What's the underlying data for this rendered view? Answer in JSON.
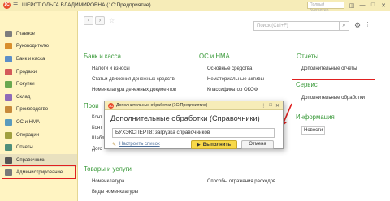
{
  "window": {
    "logo": "1С",
    "title": "ШЕРСТ ОЛЬГА ВЛАДИМИРОВНА  (1С:Предприятие)",
    "search_hint": "Полный Бухгалтер",
    "controls": [
      "◫",
      "—",
      "□",
      "✕"
    ]
  },
  "sidebar": {
    "items": [
      {
        "label": "Главное",
        "icon_color": "#7d7d7d"
      },
      {
        "label": "Руководителю",
        "icon_color": "#d98f2d"
      },
      {
        "label": "Банк и касса",
        "icon_color": "#5d8fc7"
      },
      {
        "label": "Продажи",
        "icon_color": "#d45a5a"
      },
      {
        "label": "Покупки",
        "icon_color": "#6aa84f"
      },
      {
        "label": "Склад",
        "icon_color": "#8f6bb8"
      },
      {
        "label": "Производство",
        "icon_color": "#c78a3b"
      },
      {
        "label": "ОС и НМА",
        "icon_color": "#5a9bbd"
      },
      {
        "label": "Операции",
        "icon_color": "#a0a040"
      },
      {
        "label": "Отчеты",
        "icon_color": "#4f8f7a"
      },
      {
        "label": "Справочники",
        "icon_color": "#555555"
      },
      {
        "label": "Администрирование",
        "icon_color": "#7a7a7a"
      }
    ],
    "active_index": 10
  },
  "toolbar": {
    "back": "‹",
    "forward": "›",
    "star": "☆",
    "search_placeholder": "Поиск (Ctrl+F)",
    "search_btn": "⌕",
    "gear": "⚙",
    "more": "⋮"
  },
  "sections": {
    "bank": {
      "title": "Банк и касса",
      "items": [
        "Налоги и взносы",
        "Статьи движения денежных средств",
        "Номенклатура денежных документов"
      ]
    },
    "os": {
      "title": "ОС и НМА",
      "items": [
        "Основные средства",
        "Нематериальные активы",
        "Классификатор ОКОФ"
      ]
    },
    "reports": {
      "title": "Отчеты",
      "items": [
        "Дополнительные отчеты"
      ]
    },
    "service": {
      "title": "Сервис",
      "items": [
        "Дополнительные обработки"
      ]
    },
    "info": {
      "title": "Информация",
      "items": [
        "Новости"
      ]
    },
    "hidden_left": {
      "title": "Прои",
      "items": [
        "Конт",
        "Конт",
        "Шабл",
        "Дого"
      ]
    },
    "goods": {
      "title": "Товары и услуги",
      "items": [
        "Номенклатура",
        "Виды номенклатуры"
      ]
    },
    "extra_item": "Способы отражения расходов"
  },
  "dialog": {
    "logo": "1С",
    "bar_title": "Дополнительные обработки  (1С:Предприятие)",
    "bar_controls": [
      "⋮",
      "□",
      "✕"
    ],
    "title": "Дополнительные обработки (Справочники)",
    "input_value": "БУХЭКСПЕРТ8: загрузка справочников",
    "link": "Настроить список",
    "execute": "Выполнить",
    "execute_icon": "▶",
    "cancel": "Отмена"
  },
  "colors": {
    "titlebar": "#f6ecb8",
    "sidebar": "#fff4c2",
    "section_header": "#3a9a3a",
    "highlight": "#e02020",
    "primary_button": "#f8d949"
  }
}
